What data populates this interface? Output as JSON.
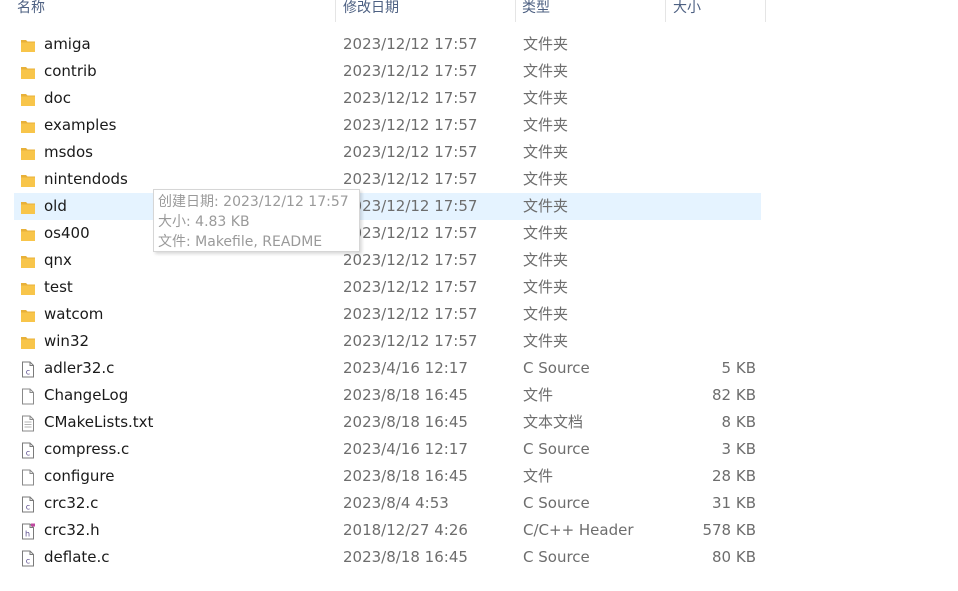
{
  "columns": {
    "name": "名称",
    "modified": "修改日期",
    "type": "类型",
    "size": "大小"
  },
  "files": [
    {
      "name": "amiga",
      "modified": "2023/12/12 17:57",
      "type": "文件夹",
      "size": "",
      "icon": "folder-icon"
    },
    {
      "name": "contrib",
      "modified": "2023/12/12 17:57",
      "type": "文件夹",
      "size": "",
      "icon": "folder-icon"
    },
    {
      "name": "doc",
      "modified": "2023/12/12 17:57",
      "type": "文件夹",
      "size": "",
      "icon": "folder-icon"
    },
    {
      "name": "examples",
      "modified": "2023/12/12 17:57",
      "type": "文件夹",
      "size": "",
      "icon": "folder-icon"
    },
    {
      "name": "msdos",
      "modified": "2023/12/12 17:57",
      "type": "文件夹",
      "size": "",
      "icon": "folder-icon"
    },
    {
      "name": "nintendods",
      "modified": "2023/12/12 17:57",
      "type": "文件夹",
      "size": "",
      "icon": "folder-icon"
    },
    {
      "name": "old",
      "modified": "2023/12/12 17:57",
      "type": "文件夹",
      "size": "",
      "icon": "folder-icon",
      "hover": true
    },
    {
      "name": "os400",
      "modified": "2023/12/12 17:57",
      "type": "文件夹",
      "size": "",
      "icon": "folder-icon"
    },
    {
      "name": "qnx",
      "modified": "2023/12/12 17:57",
      "type": "文件夹",
      "size": "",
      "icon": "folder-icon"
    },
    {
      "name": "test",
      "modified": "2023/12/12 17:57",
      "type": "文件夹",
      "size": "",
      "icon": "folder-icon"
    },
    {
      "name": "watcom",
      "modified": "2023/12/12 17:57",
      "type": "文件夹",
      "size": "",
      "icon": "folder-icon"
    },
    {
      "name": "win32",
      "modified": "2023/12/12 17:57",
      "type": "文件夹",
      "size": "",
      "icon": "folder-icon"
    },
    {
      "name": "adler32.c",
      "modified": "2023/4/16 12:17",
      "type": "C Source",
      "size": "5 KB",
      "icon": "c-source-file-icon"
    },
    {
      "name": "ChangeLog",
      "modified": "2023/8/18 16:45",
      "type": "文件",
      "size": "82 KB",
      "icon": "blank-file-icon"
    },
    {
      "name": "CMakeLists.txt",
      "modified": "2023/8/18 16:45",
      "type": "文本文档",
      "size": "8 KB",
      "icon": "text-file-icon"
    },
    {
      "name": "compress.c",
      "modified": "2023/4/16 12:17",
      "type": "C Source",
      "size": "3 KB",
      "icon": "c-source-file-icon"
    },
    {
      "name": "configure",
      "modified": "2023/8/18 16:45",
      "type": "文件",
      "size": "28 KB",
      "icon": "blank-file-icon"
    },
    {
      "name": "crc32.c",
      "modified": "2023/8/4 4:53",
      "type": "C Source",
      "size": "31 KB",
      "icon": "c-source-file-icon"
    },
    {
      "name": "crc32.h",
      "modified": "2018/12/27 4:26",
      "type": "C/C++ Header",
      "size": "578 KB",
      "icon": "header-file-icon"
    },
    {
      "name": "deflate.c",
      "modified": "2023/8/18 16:45",
      "type": "C Source",
      "size": "80 KB",
      "icon": "c-source-file-icon"
    }
  ],
  "tooltip": {
    "created": "创建日期: 2023/12/12 17:57",
    "size": "大小: 4.83 KB",
    "files": "文件: Makefile, README"
  },
  "colors": {
    "hover_bg": "#e5f3ff",
    "folder": "#f8c54a",
    "header_text": "#4d6082"
  }
}
